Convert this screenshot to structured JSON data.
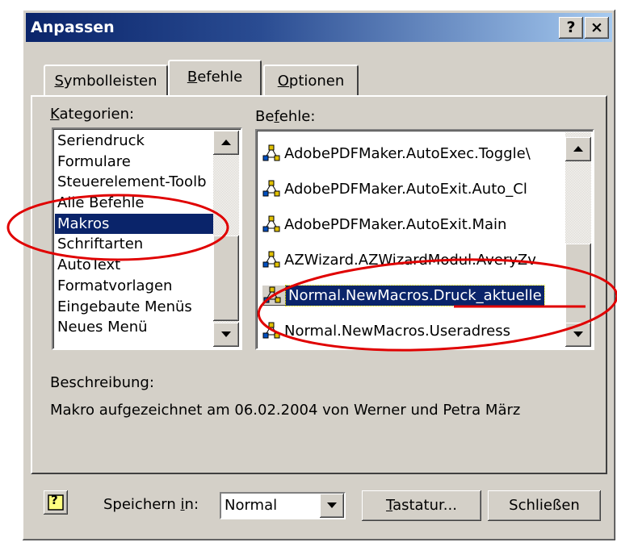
{
  "window": {
    "title": "Anpassen",
    "help_button": "?",
    "close_button": "×"
  },
  "tabs": [
    {
      "label": "Symbolleisten",
      "hotkey": "S",
      "rest": "ymbolleisten",
      "active": false
    },
    {
      "label": "Befehle",
      "hotkey": "B",
      "rest": "efehle",
      "active": true
    },
    {
      "label": "Optionen",
      "hotkey": "O",
      "rest": "ptionen",
      "active": false
    }
  ],
  "categories": {
    "label_hotkey": "K",
    "label_rest": "ategorien:",
    "items": [
      "Seriendruck",
      "Formulare",
      "Steuerelement-Toolb",
      "Alle Befehle",
      "Makros",
      "Schriftarten",
      "AutoText",
      "Formatvorlagen",
      "Eingebaute Menüs",
      "Neues Menü"
    ],
    "selected": "Makros"
  },
  "commands": {
    "label_hotkey": "f",
    "label_pre": "Be",
    "label_rest": "ehle:",
    "items": [
      "AdobePDFMaker.AutoExec.Toggle\\",
      "AdobePDFMaker.AutoExit.Auto_Cl",
      "AdobePDFMaker.AutoExit.Main",
      "AZWizard.AZWizardModul.AveryZv",
      "Normal.NewMacros.Druck_aktuelle",
      "Normal.NewMacros.Useradress"
    ],
    "item_icon": "macro-icon",
    "selected": "Normal.NewMacros.Druck_aktuelle"
  },
  "description": {
    "label": "Beschreibung:",
    "text": "Makro aufgezeichnet am 06.02.2004 von Werner und Petra März"
  },
  "footer": {
    "help_icon": "?",
    "save_in_label_pre": "Speichern ",
    "save_in_hotkey": "i",
    "save_in_label_rest": "n:",
    "save_in_value": "Normal",
    "keyboard_hotkey": "T",
    "keyboard_rest": "astatur...",
    "close_label": "Schließen"
  },
  "colors": {
    "selection": "#0a246a",
    "annotation": "#e00000",
    "dialog_bg": "#d4d0c8"
  }
}
